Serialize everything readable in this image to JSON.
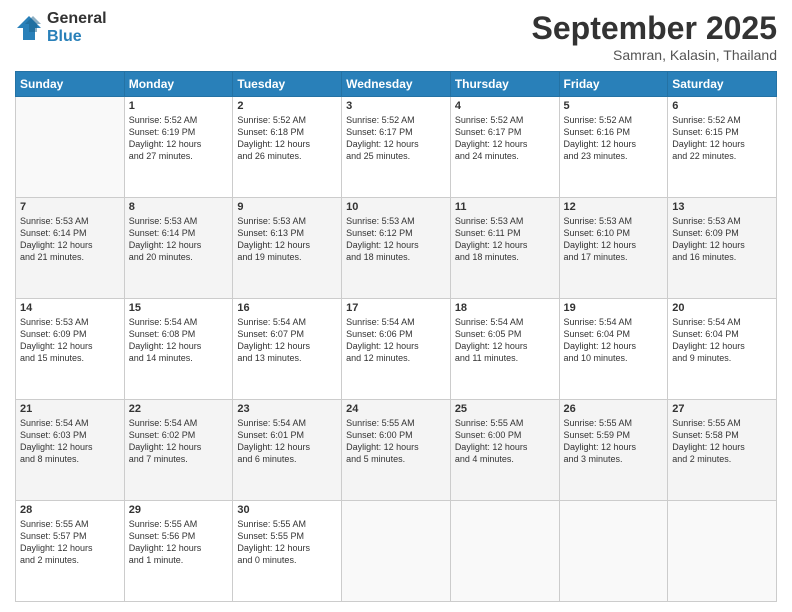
{
  "logo": {
    "general": "General",
    "blue": "Blue"
  },
  "header": {
    "month": "September 2025",
    "location": "Samran, Kalasin, Thailand"
  },
  "weekdays": [
    "Sunday",
    "Monday",
    "Tuesday",
    "Wednesday",
    "Thursday",
    "Friday",
    "Saturday"
  ],
  "weeks": [
    [
      {
        "day": "",
        "info": ""
      },
      {
        "day": "1",
        "info": "Sunrise: 5:52 AM\nSunset: 6:19 PM\nDaylight: 12 hours\nand 27 minutes."
      },
      {
        "day": "2",
        "info": "Sunrise: 5:52 AM\nSunset: 6:18 PM\nDaylight: 12 hours\nand 26 minutes."
      },
      {
        "day": "3",
        "info": "Sunrise: 5:52 AM\nSunset: 6:17 PM\nDaylight: 12 hours\nand 25 minutes."
      },
      {
        "day": "4",
        "info": "Sunrise: 5:52 AM\nSunset: 6:17 PM\nDaylight: 12 hours\nand 24 minutes."
      },
      {
        "day": "5",
        "info": "Sunrise: 5:52 AM\nSunset: 6:16 PM\nDaylight: 12 hours\nand 23 minutes."
      },
      {
        "day": "6",
        "info": "Sunrise: 5:52 AM\nSunset: 6:15 PM\nDaylight: 12 hours\nand 22 minutes."
      }
    ],
    [
      {
        "day": "7",
        "info": "Sunrise: 5:53 AM\nSunset: 6:14 PM\nDaylight: 12 hours\nand 21 minutes."
      },
      {
        "day": "8",
        "info": "Sunrise: 5:53 AM\nSunset: 6:14 PM\nDaylight: 12 hours\nand 20 minutes."
      },
      {
        "day": "9",
        "info": "Sunrise: 5:53 AM\nSunset: 6:13 PM\nDaylight: 12 hours\nand 19 minutes."
      },
      {
        "day": "10",
        "info": "Sunrise: 5:53 AM\nSunset: 6:12 PM\nDaylight: 12 hours\nand 18 minutes."
      },
      {
        "day": "11",
        "info": "Sunrise: 5:53 AM\nSunset: 6:11 PM\nDaylight: 12 hours\nand 18 minutes."
      },
      {
        "day": "12",
        "info": "Sunrise: 5:53 AM\nSunset: 6:10 PM\nDaylight: 12 hours\nand 17 minutes."
      },
      {
        "day": "13",
        "info": "Sunrise: 5:53 AM\nSunset: 6:09 PM\nDaylight: 12 hours\nand 16 minutes."
      }
    ],
    [
      {
        "day": "14",
        "info": "Sunrise: 5:53 AM\nSunset: 6:09 PM\nDaylight: 12 hours\nand 15 minutes."
      },
      {
        "day": "15",
        "info": "Sunrise: 5:54 AM\nSunset: 6:08 PM\nDaylight: 12 hours\nand 14 minutes."
      },
      {
        "day": "16",
        "info": "Sunrise: 5:54 AM\nSunset: 6:07 PM\nDaylight: 12 hours\nand 13 minutes."
      },
      {
        "day": "17",
        "info": "Sunrise: 5:54 AM\nSunset: 6:06 PM\nDaylight: 12 hours\nand 12 minutes."
      },
      {
        "day": "18",
        "info": "Sunrise: 5:54 AM\nSunset: 6:05 PM\nDaylight: 12 hours\nand 11 minutes."
      },
      {
        "day": "19",
        "info": "Sunrise: 5:54 AM\nSunset: 6:04 PM\nDaylight: 12 hours\nand 10 minutes."
      },
      {
        "day": "20",
        "info": "Sunrise: 5:54 AM\nSunset: 6:04 PM\nDaylight: 12 hours\nand 9 minutes."
      }
    ],
    [
      {
        "day": "21",
        "info": "Sunrise: 5:54 AM\nSunset: 6:03 PM\nDaylight: 12 hours\nand 8 minutes."
      },
      {
        "day": "22",
        "info": "Sunrise: 5:54 AM\nSunset: 6:02 PM\nDaylight: 12 hours\nand 7 minutes."
      },
      {
        "day": "23",
        "info": "Sunrise: 5:54 AM\nSunset: 6:01 PM\nDaylight: 12 hours\nand 6 minutes."
      },
      {
        "day": "24",
        "info": "Sunrise: 5:55 AM\nSunset: 6:00 PM\nDaylight: 12 hours\nand 5 minutes."
      },
      {
        "day": "25",
        "info": "Sunrise: 5:55 AM\nSunset: 6:00 PM\nDaylight: 12 hours\nand 4 minutes."
      },
      {
        "day": "26",
        "info": "Sunrise: 5:55 AM\nSunset: 5:59 PM\nDaylight: 12 hours\nand 3 minutes."
      },
      {
        "day": "27",
        "info": "Sunrise: 5:55 AM\nSunset: 5:58 PM\nDaylight: 12 hours\nand 2 minutes."
      }
    ],
    [
      {
        "day": "28",
        "info": "Sunrise: 5:55 AM\nSunset: 5:57 PM\nDaylight: 12 hours\nand 2 minutes."
      },
      {
        "day": "29",
        "info": "Sunrise: 5:55 AM\nSunset: 5:56 PM\nDaylight: 12 hours\nand 1 minute."
      },
      {
        "day": "30",
        "info": "Sunrise: 5:55 AM\nSunset: 5:55 PM\nDaylight: 12 hours\nand 0 minutes."
      },
      {
        "day": "",
        "info": ""
      },
      {
        "day": "",
        "info": ""
      },
      {
        "day": "",
        "info": ""
      },
      {
        "day": "",
        "info": ""
      }
    ]
  ]
}
